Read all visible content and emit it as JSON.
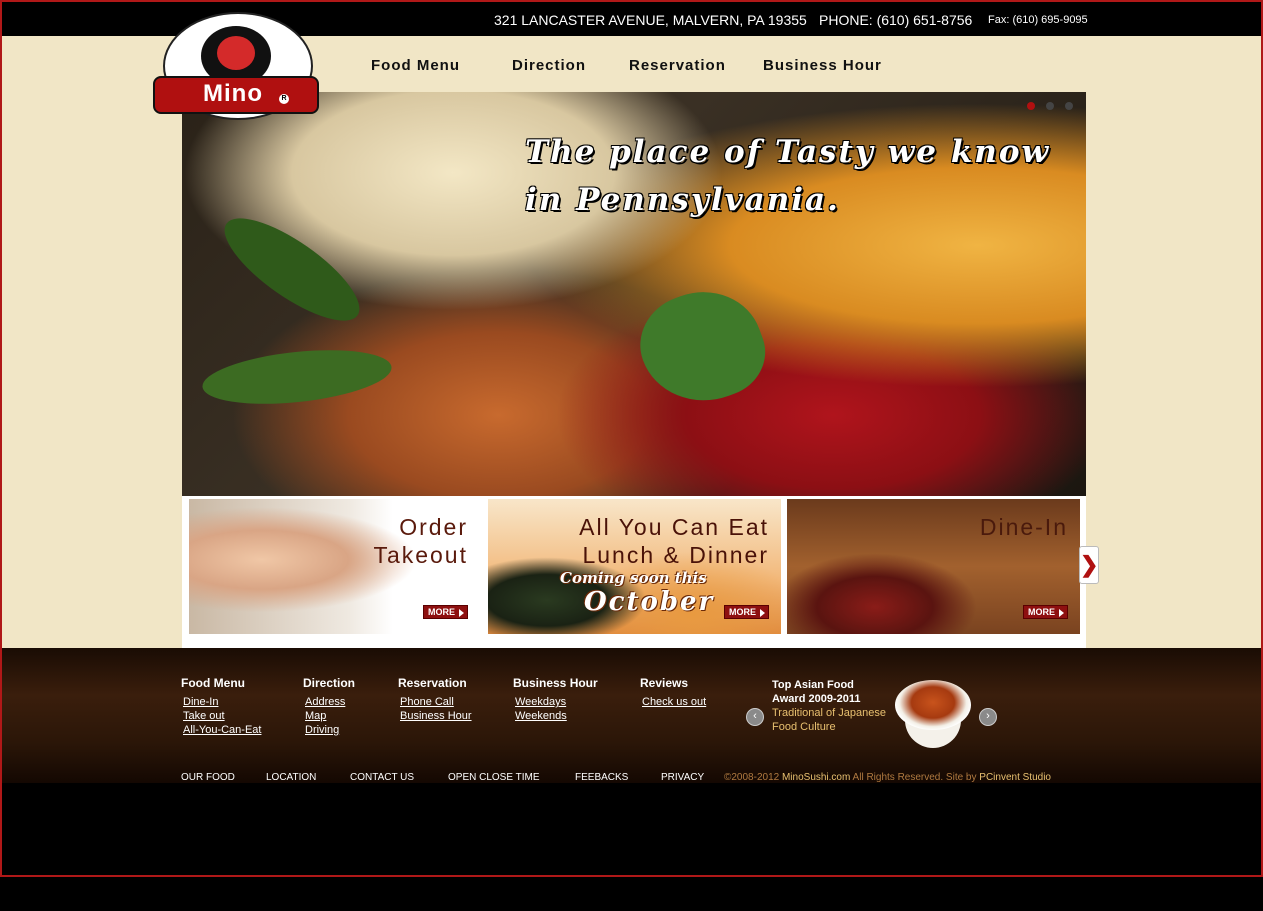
{
  "header": {
    "address": "321 LANCASTER AVENUE, MALVERN, PA 19355",
    "phone": "PHONE: (610) 651-8756",
    "fax": "Fax: (610) 695-9095"
  },
  "logo": {
    "name": "Mino",
    "reg": "R"
  },
  "nav": [
    "Food Menu",
    "Direction",
    "Reservation",
    "Business Hour"
  ],
  "hero": {
    "tagline_line1": "The place of Tasty we know",
    "tagline_line2": "in Pennsylvania.",
    "slides_total": 3,
    "active_slide": 1
  },
  "promos": [
    {
      "line1": "Order",
      "line2": "Takeout",
      "more": "MORE"
    },
    {
      "line1": "All You Can Eat",
      "line2": "Lunch & Dinner",
      "soon": "Coming soon this",
      "month": "October",
      "more": "MORE"
    },
    {
      "line1": "Dine-In",
      "more": "MORE"
    }
  ],
  "next_arrow": "❯",
  "footer": {
    "columns": [
      {
        "title": "Food Menu",
        "links": [
          "Dine-In",
          "Take out",
          "All-You-Can-Eat"
        ]
      },
      {
        "title": "Direction",
        "links": [
          "Address",
          "Map",
          "Driving"
        ]
      },
      {
        "title": "Reservation",
        "links": [
          "Phone Call",
          "Business Hour"
        ]
      },
      {
        "title": "Business Hour",
        "links": [
          "Weekdays",
          "Weekends"
        ]
      },
      {
        "title": "Reviews",
        "links": [
          "Check us out"
        ]
      }
    ],
    "award": {
      "line1": "Top Asian Food",
      "line2": "Award 2009-2011",
      "line3": "Traditional of Japanese",
      "line4": "Food Culture"
    },
    "prev": "‹",
    "next": "›",
    "bottom_nav": [
      "OUR FOOD",
      "LOCATION",
      "CONTACT US",
      "OPEN CLOSE TIME",
      "FEEBACKS",
      "PRIVACY"
    ],
    "copyright_prefix": "©2008-2012 ",
    "site": "MinoSushi.com",
    "copyright_mid": " All Rights Reserved. Site by ",
    "studio": "PCinvent Studio"
  },
  "colors": {
    "accent_red": "#b01010",
    "paper": "#f1e6c6",
    "footer_brown": "#3a1e0c",
    "gold_text": "#e8c070"
  }
}
